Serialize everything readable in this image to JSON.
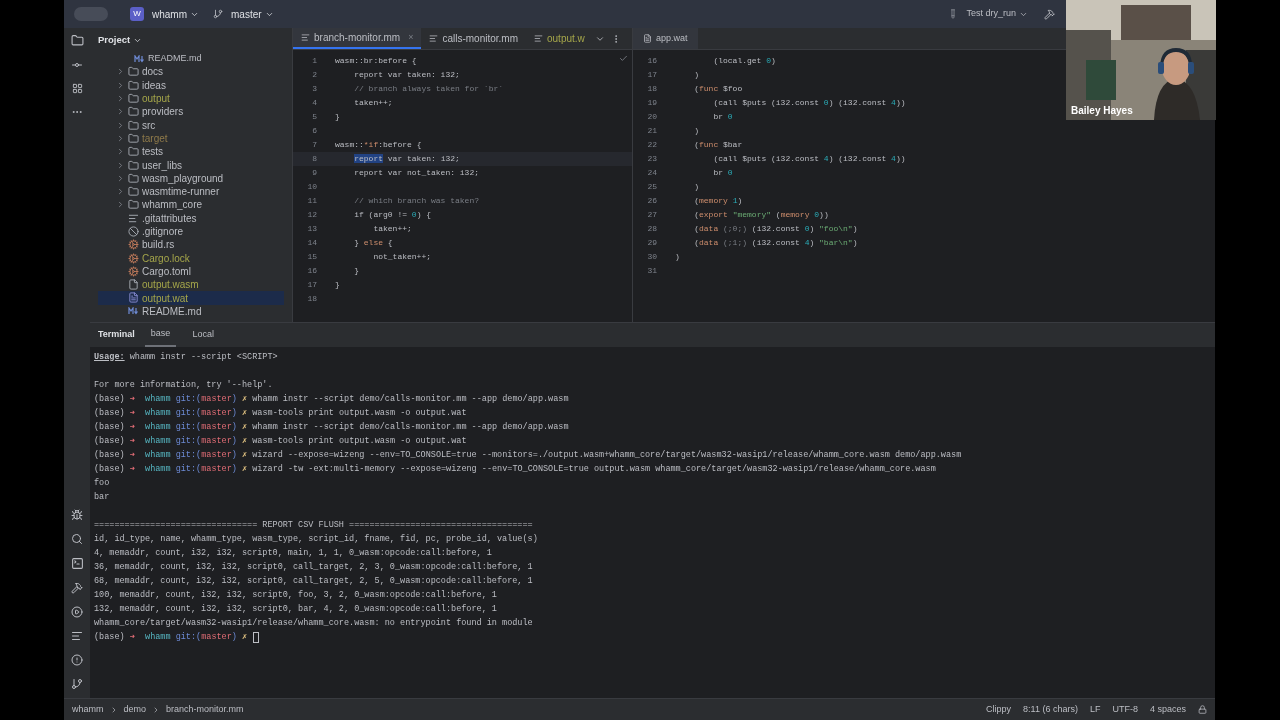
{
  "toolbar": {
    "project_badge": "W",
    "project": "whamm",
    "branch": "master",
    "run_config": "Test dry_run"
  },
  "project_panel": {
    "title": "Project",
    "partial_item": {
      "name": "README.md",
      "kind": "md"
    },
    "items": [
      {
        "name": "docs",
        "kind": "folder",
        "expandable": true,
        "selected": false
      },
      {
        "name": "ideas",
        "kind": "folder",
        "expandable": true,
        "selected": false
      },
      {
        "name": "output",
        "kind": "folder",
        "expandable": true,
        "selected": false,
        "color": "#a5a64a"
      },
      {
        "name": "providers",
        "kind": "folder",
        "expandable": true,
        "selected": false
      },
      {
        "name": "src",
        "kind": "folder",
        "expandable": true,
        "selected": false
      },
      {
        "name": "target",
        "kind": "folder",
        "expandable": true,
        "selected": false,
        "color": "#8f7a4a"
      },
      {
        "name": "tests",
        "kind": "folder",
        "expandable": true,
        "selected": false
      },
      {
        "name": "user_libs",
        "kind": "folder",
        "expandable": true,
        "selected": false
      },
      {
        "name": "wasm_playground",
        "kind": "folder",
        "expandable": true,
        "selected": false
      },
      {
        "name": "wasmtime-runner",
        "kind": "folder",
        "expandable": true,
        "selected": false
      },
      {
        "name": "whamm_core",
        "kind": "folder",
        "expandable": true,
        "selected": false
      },
      {
        "name": ".gitattributes",
        "kind": "text",
        "expandable": false,
        "selected": false
      },
      {
        "name": ".gitignore",
        "kind": "ignore",
        "expandable": false,
        "selected": false
      },
      {
        "name": "build.rs",
        "kind": "rust",
        "expandable": false,
        "selected": false
      },
      {
        "name": "Cargo.lock",
        "kind": "rust",
        "expandable": false,
        "selected": false,
        "color": "#a5a64a"
      },
      {
        "name": "Cargo.toml",
        "kind": "rust",
        "expandable": false,
        "selected": false
      },
      {
        "name": "output.wasm",
        "kind": "file",
        "expandable": false,
        "selected": false,
        "color": "#a5a64a"
      },
      {
        "name": "output.wat",
        "kind": "wat",
        "expandable": false,
        "selected": true,
        "color": "#a5a64a"
      },
      {
        "name": "README.md",
        "kind": "md",
        "expandable": false,
        "selected": false
      }
    ]
  },
  "editor_tabs": [
    {
      "label": "branch-monitor.mm",
      "selected": true,
      "close": "×"
    },
    {
      "label": "calls-monitor.mm",
      "selected": false
    },
    {
      "label": "output.w",
      "selected": false,
      "color": "#a5a64a"
    }
  ],
  "left_editor": {
    "lines": [
      {
        "num": "1",
        "tokens": [
          {
            "kind": "text",
            "text": "wasm::br:before {"
          }
        ]
      },
      {
        "num": "2",
        "tokens": [
          {
            "kind": "text",
            "text": "    report var taken: i32;"
          }
        ]
      },
      {
        "num": "3",
        "tokens": [
          {
            "kind": "comment",
            "text": "    // branch always taken for `br`"
          }
        ]
      },
      {
        "num": "4",
        "tokens": [
          {
            "kind": "text",
            "text": "    taken++;"
          }
        ]
      },
      {
        "num": "5",
        "tokens": [
          {
            "kind": "text",
            "text": "}"
          }
        ]
      },
      {
        "num": "6"
      },
      {
        "num": "7",
        "tokens": [
          {
            "kind": "text",
            "text": "wasm::"
          },
          {
            "kind": "kw",
            "text": "*if"
          },
          {
            "kind": "text",
            "text": ":before {"
          }
        ]
      },
      {
        "num": "8",
        "current": true,
        "tokens": [
          {
            "kind": "hl",
            "text": "    report"
          },
          {
            "kind": "text",
            "text": " var taken: i32;"
          }
        ]
      },
      {
        "num": "9",
        "tokens": [
          {
            "kind": "text",
            "text": "    report var not_taken: i32;"
          }
        ]
      },
      {
        "num": "10"
      },
      {
        "num": "11",
        "tokens": [
          {
            "kind": "comment",
            "text": "    // which branch was taken?"
          }
        ]
      },
      {
        "num": "12",
        "tokens": [
          {
            "kind": "text",
            "text": "    if (arg0 != "
          },
          {
            "kind": "num",
            "text": "0"
          },
          {
            "kind": "text",
            "text": ") {"
          }
        ]
      },
      {
        "num": "13",
        "tokens": [
          {
            "kind": "text",
            "text": "        taken++;"
          }
        ]
      },
      {
        "num": "14",
        "tokens": [
          {
            "kind": "text",
            "text": "    } "
          },
          {
            "kind": "kw",
            "text": "else"
          },
          {
            "kind": "text",
            "text": " {"
          }
        ]
      },
      {
        "num": "15",
        "tokens": [
          {
            "kind": "text",
            "text": "        not_taken++;"
          }
        ]
      },
      {
        "num": "16",
        "tokens": [
          {
            "kind": "text",
            "text": "    }"
          }
        ]
      },
      {
        "num": "17",
        "tokens": [
          {
            "kind": "text",
            "text": "}"
          }
        ]
      },
      {
        "num": "18"
      }
    ]
  },
  "right_tab": {
    "label": "app.wat",
    "selected": true
  },
  "right_editor": {
    "lines": [
      {
        "num": "16",
        "tokens": [
          {
            "kind": "text",
            "text": "        (local.get "
          },
          {
            "kind": "num",
            "text": "0"
          },
          {
            "kind": "text",
            "text": ")"
          }
        ]
      },
      {
        "num": "17",
        "tokens": [
          {
            "kind": "text",
            "text": "    )"
          }
        ]
      },
      {
        "num": "18",
        "tokens": [
          {
            "kind": "text",
            "text": "    ("
          },
          {
            "kind": "kw",
            "text": "func"
          },
          {
            "kind": "text",
            "text": " $foo"
          }
        ]
      },
      {
        "num": "19",
        "tokens": [
          {
            "kind": "text",
            "text": "        (call $puts (i32.const "
          },
          {
            "kind": "num",
            "text": "0"
          },
          {
            "kind": "text",
            "text": ") (i32.const "
          },
          {
            "kind": "num",
            "text": "4"
          },
          {
            "kind": "text",
            "text": "))"
          }
        ]
      },
      {
        "num": "20",
        "tokens": [
          {
            "kind": "text",
            "text": "        br "
          },
          {
            "kind": "num",
            "text": "0"
          }
        ]
      },
      {
        "num": "21",
        "tokens": [
          {
            "kind": "text",
            "text": "    )"
          }
        ]
      },
      {
        "num": "22",
        "tokens": [
          {
            "kind": "text",
            "text": "    ("
          },
          {
            "kind": "kw",
            "text": "func"
          },
          {
            "kind": "text",
            "text": " $bar"
          }
        ]
      },
      {
        "num": "23",
        "tokens": [
          {
            "kind": "text",
            "text": "        (call $puts (i32.const "
          },
          {
            "kind": "num",
            "text": "4"
          },
          {
            "kind": "text",
            "text": ") (i32.const "
          },
          {
            "kind": "num",
            "text": "4"
          },
          {
            "kind": "text",
            "text": "))"
          }
        ]
      },
      {
        "num": "24",
        "tokens": [
          {
            "kind": "text",
            "text": "        br "
          },
          {
            "kind": "num",
            "text": "0"
          }
        ]
      },
      {
        "num": "25",
        "tokens": [
          {
            "kind": "text",
            "text": "    )"
          }
        ]
      },
      {
        "num": "26",
        "tokens": [
          {
            "kind": "text",
            "text": "    ("
          },
          {
            "kind": "kw",
            "text": "memory"
          },
          {
            "kind": "num",
            "text": " 1"
          },
          {
            "kind": "text",
            "text": ")"
          }
        ]
      },
      {
        "num": "27",
        "tokens": [
          {
            "kind": "text",
            "text": "    ("
          },
          {
            "kind": "kw",
            "text": "export"
          },
          {
            "kind": "string",
            "text": " \"memory\""
          },
          {
            "kind": "text",
            "text": " ("
          },
          {
            "kind": "kw",
            "text": "memory"
          },
          {
            "kind": "num",
            "text": " 0"
          },
          {
            "kind": "text",
            "text": "))"
          }
        ]
      },
      {
        "num": "28",
        "tokens": [
          {
            "kind": "text",
            "text": "    ("
          },
          {
            "kind": "kw",
            "text": "data"
          },
          {
            "kind": "comment",
            "text": " (;0;)"
          },
          {
            "kind": "text",
            "text": " (i32.const "
          },
          {
            "kind": "num",
            "text": "0"
          },
          {
            "kind": "text",
            "text": ") "
          },
          {
            "kind": "string",
            "text": "\"foo\\n\""
          },
          {
            "kind": "text",
            "text": ")"
          }
        ]
      },
      {
        "num": "29",
        "tokens": [
          {
            "kind": "text",
            "text": "    ("
          },
          {
            "kind": "kw",
            "text": "data"
          },
          {
            "kind": "comment",
            "text": " (;1;)"
          },
          {
            "kind": "text",
            "text": " (i32.const "
          },
          {
            "kind": "num",
            "text": "4"
          },
          {
            "kind": "text",
            "text": ") "
          },
          {
            "kind": "string",
            "text": "\"bar\\n\""
          },
          {
            "kind": "text",
            "text": ")"
          }
        ]
      },
      {
        "num": "30",
        "tokens": [
          {
            "kind": "text",
            "text": ")"
          }
        ]
      },
      {
        "num": "31"
      }
    ]
  },
  "terminal": {
    "title": "Terminal",
    "tabs": [
      {
        "label": "base",
        "selected": true
      },
      {
        "label": "Local",
        "selected": false
      }
    ],
    "lines": [
      {
        "kind": "usage",
        "label": "Usage:",
        "text": " whamm instr --script <SCRIPT>"
      },
      {
        "kind": "blank"
      },
      {
        "kind": "output",
        "text": "For more information, try '--help'."
      },
      {
        "kind": "prompt",
        "env": "(base)",
        "arrow": "➜",
        "dir": "whamm",
        "git": "git:(",
        "branch": "master",
        "close": ")",
        "dirty": "✗",
        "command": "whamm instr --script demo/calls-monitor.mm --app demo/app.wasm"
      },
      {
        "kind": "prompt",
        "env": "(base)",
        "arrow": "➜",
        "dir": "whamm",
        "git": "git:(",
        "branch": "master",
        "close": ")",
        "dirty": "✗",
        "command": "wasm-tools print output.wasm -o output.wat"
      },
      {
        "kind": "prompt",
        "env": "(base)",
        "arrow": "➜",
        "dir": "whamm",
        "git": "git:(",
        "branch": "master",
        "close": ")",
        "dirty": "✗",
        "command": "whamm instr --script demo/calls-monitor.mm --app demo/app.wasm"
      },
      {
        "kind": "prompt",
        "env": "(base)",
        "arrow": "➜",
        "dir": "whamm",
        "git": "git:(",
        "branch": "master",
        "close": ")",
        "dirty": "✗",
        "command": "wasm-tools print output.wasm -o output.wat"
      },
      {
        "kind": "prompt",
        "env": "(base)",
        "arrow": "➜",
        "dir": "whamm",
        "git": "git:(",
        "branch": "master",
        "close": ")",
        "dirty": "✗",
        "command": "wizard --expose=wizeng --env=TO_CONSOLE=true --monitors=./output.wasm+whamm_core/target/wasm32-wasip1/release/whamm_core.wasm demo/app.wasm"
      },
      {
        "kind": "prompt",
        "env": "(base)",
        "arrow": "➜",
        "dir": "whamm",
        "git": "git:(",
        "branch": "master",
        "close": ")",
        "dirty": "✗",
        "command": "wizard -tw -ext:multi-memory --expose=wizeng --env=TO_CONSOLE=true output.wasm whamm_core/target/wasm32-wasip1/release/whamm_core.wasm"
      },
      {
        "kind": "output",
        "text": "foo"
      },
      {
        "kind": "output",
        "text": "bar"
      },
      {
        "kind": "blank"
      },
      {
        "kind": "output",
        "text": "================================ REPORT CSV FLUSH ===================================="
      },
      {
        "kind": "output",
        "text": "id, id_type, name, whamm_type, wasm_type, script_id, fname, fid, pc, probe_id, value(s)"
      },
      {
        "kind": "output",
        "text": "4, memaddr, count, i32, i32, script0, main, 1, 1, 0_wasm:opcode:call:before, 1"
      },
      {
        "kind": "output",
        "text": "36, memaddr, count, i32, i32, script0, call_target, 2, 3, 0_wasm:opcode:call:before, 1"
      },
      {
        "kind": "output",
        "text": "68, memaddr, count, i32, i32, script0, call_target, 2, 5, 0_wasm:opcode:call:before, 1"
      },
      {
        "kind": "output",
        "text": "100, memaddr, count, i32, i32, script0, foo, 3, 2, 0_wasm:opcode:call:before, 1"
      },
      {
        "kind": "output",
        "text": "132, memaddr, count, i32, i32, script0, bar, 4, 2, 0_wasm:opcode:call:before, 1"
      },
      {
        "kind": "output",
        "text": "whamm_core/target/wasm32-wasip1/release/whamm_core.wasm: no entrypoint found in module"
      },
      {
        "kind": "prompt",
        "env": "(base)",
        "arrow": "➜",
        "dir": "whamm",
        "git": "git:(",
        "branch": "master",
        "close": ")",
        "dirty": "✗",
        "cursor": true
      }
    ]
  },
  "status_bar": {
    "breadcrumbs": [
      "whamm",
      "demo",
      "branch-monitor.mm"
    ],
    "linter": "Clippy",
    "position": "8:11 (6 chars)",
    "line_ending": "LF",
    "encoding": "UTF-8",
    "indent": "4 spaces"
  },
  "video": {
    "kind": "picture",
    "name": "Bailey Hayes"
  }
}
